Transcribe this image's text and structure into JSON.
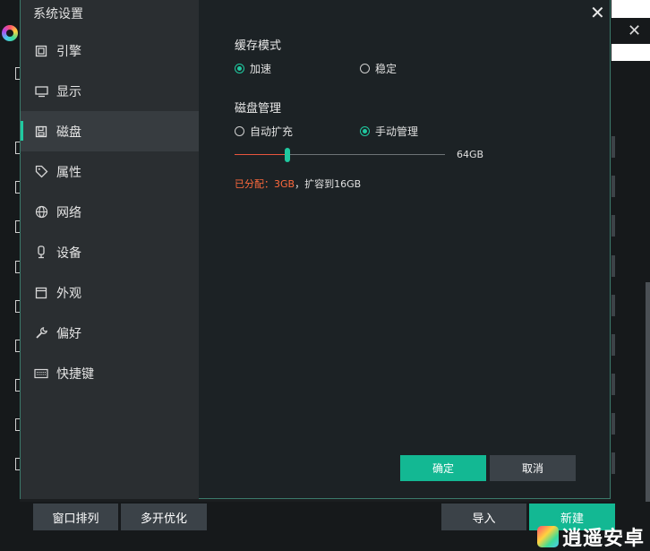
{
  "dialog": {
    "title": "系统设置",
    "nav": [
      {
        "label": "引擎",
        "icon": "cpu-icon"
      },
      {
        "label": "显示",
        "icon": "monitor-icon"
      },
      {
        "label": "磁盘",
        "icon": "disk-icon",
        "active": true
      },
      {
        "label": "属性",
        "icon": "tag-icon"
      },
      {
        "label": "网络",
        "icon": "globe-icon"
      },
      {
        "label": "设备",
        "icon": "device-icon"
      },
      {
        "label": "外观",
        "icon": "window-icon"
      },
      {
        "label": "偏好",
        "icon": "wrench-icon"
      },
      {
        "label": "快捷键",
        "icon": "keyboard-icon"
      }
    ],
    "cache": {
      "title": "缓存模式",
      "option_fast": "加速",
      "option_stable": "稳定",
      "selected": "加速"
    },
    "disk": {
      "title": "磁盘管理",
      "option_auto": "自动扩充",
      "option_manual": "手动管理",
      "selected": "手动管理",
      "slider_max_label": "64GB",
      "slider_value_fraction": 0.25,
      "allocated_text": "已分配：3GB",
      "expand_text": "，扩容到16GB"
    },
    "ok_label": "确定",
    "cancel_label": "取消"
  },
  "background_app": {
    "buttons": {
      "arrange": "窗口排列",
      "optimize": "多开优化",
      "import": "导入",
      "new": "新建"
    },
    "watermark": "逍遥安卓"
  },
  "colors": {
    "accent": "#20c9a0",
    "primary_button": "#13b893",
    "warning": "#ff6a3d"
  }
}
